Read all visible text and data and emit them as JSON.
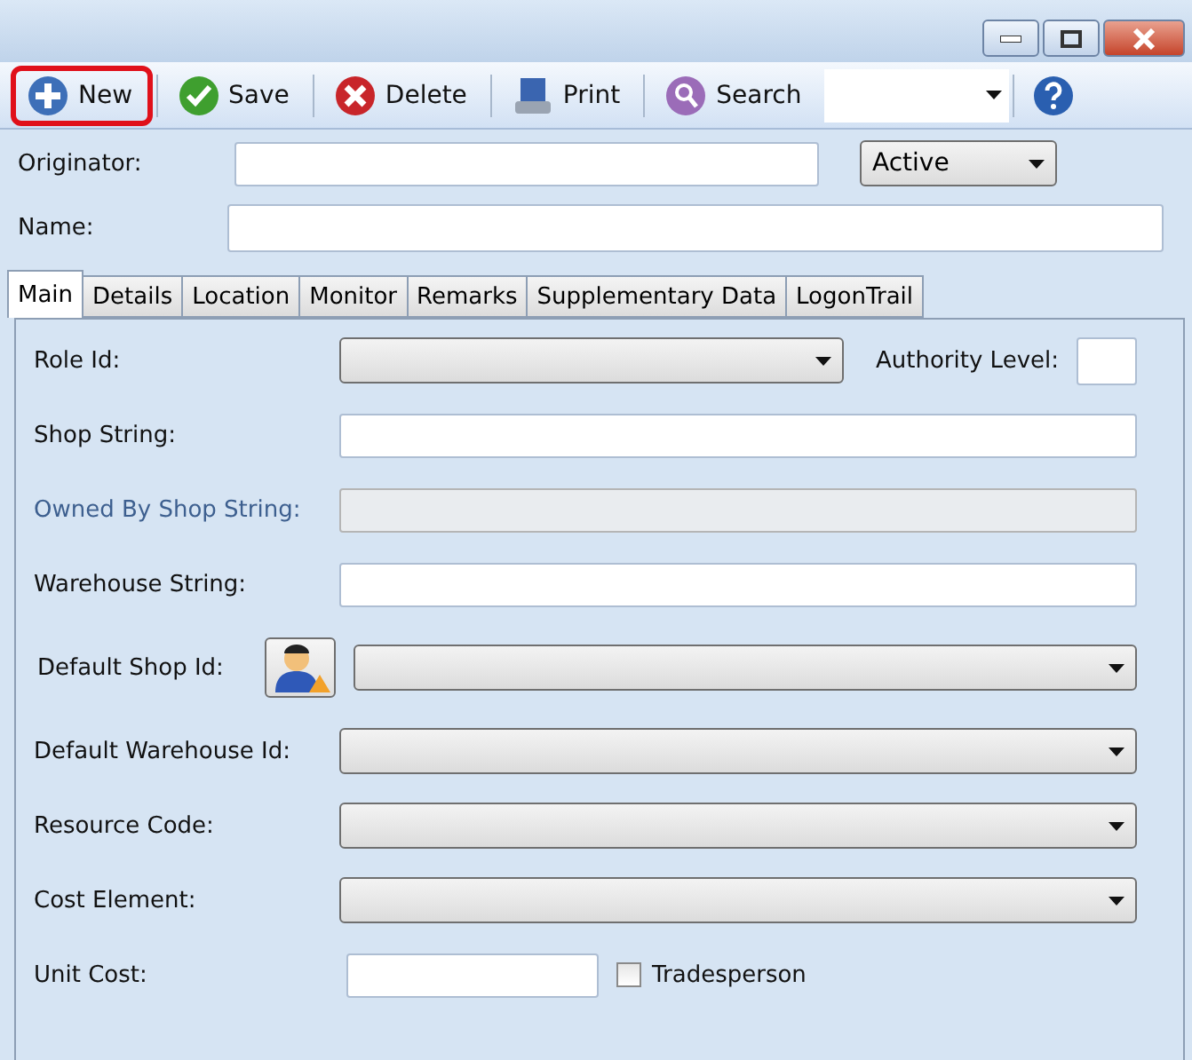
{
  "window": {
    "controls": [
      {
        "kind": "minimize"
      },
      {
        "kind": "maximize"
      },
      {
        "kind": "close"
      }
    ]
  },
  "toolbar": {
    "buttons": [
      {
        "kind": "new",
        "label": "New",
        "highlighted": true
      },
      {
        "kind": "save",
        "label": "Save",
        "highlighted": false
      },
      {
        "kind": "delete",
        "label": "Delete",
        "highlighted": false
      },
      {
        "kind": "print",
        "label": "Print",
        "highlighted": false
      },
      {
        "kind": "search",
        "label": "Search",
        "highlighted": false
      }
    ],
    "help": {
      "kind": "help"
    }
  },
  "header": {
    "originator": {
      "label": "Originator:"
    },
    "status": {
      "value": "Active"
    },
    "name": {
      "label": "Name:"
    }
  },
  "tabs": [
    {
      "label": "Main",
      "selected": true
    },
    {
      "label": "Details",
      "selected": false
    },
    {
      "label": "Location",
      "selected": false
    },
    {
      "label": "Monitor",
      "selected": false
    },
    {
      "label": "Remarks",
      "selected": false
    },
    {
      "label": "Supplementary Data",
      "selected": false
    },
    {
      "label": "LogonTrail",
      "selected": false
    }
  ],
  "form": [
    {
      "kind": "combo",
      "label": "Role Id:",
      "disabled": false,
      "extra": {
        "label": "Authority Level:"
      }
    },
    {
      "kind": "text",
      "label": "Shop String:",
      "disabled": false
    },
    {
      "kind": "text",
      "label": "Owned By Shop String:",
      "disabled": true
    },
    {
      "kind": "text",
      "label": "Warehouse String:",
      "disabled": false
    },
    {
      "kind": "lookup",
      "label": "Default Shop Id:",
      "disabled": false
    },
    {
      "kind": "combo",
      "label": "Default Warehouse Id:",
      "disabled": false
    },
    {
      "kind": "combo",
      "label": "Resource Code:",
      "disabled": false
    },
    {
      "kind": "combo",
      "label": "Cost Element:",
      "disabled": false
    },
    {
      "kind": "short",
      "label": "Unit Cost:",
      "disabled": false,
      "checkbox": {
        "label": "Tradesperson",
        "checked": false
      }
    }
  ]
}
